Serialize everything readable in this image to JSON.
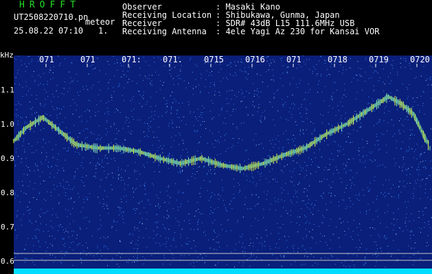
{
  "header": {
    "app_title": "HROFFT",
    "filename": "UT2508220710.pn",
    "meteor_tag": "meteor",
    "timestamp": "25.08.22 07:10",
    "count": "1.",
    "info": [
      {
        "key": "Observer",
        "value": ": Masaki Kano"
      },
      {
        "key": "Receiving Location",
        "value": ": Shibukawa, Gunma, Japan"
      },
      {
        "key": "Receiver",
        "value": ": SDR# 43dB L15 111.6MHz USB"
      },
      {
        "key": "Receiving Antenna",
        "value": ": 4ele Yagi Az 230 for Kansai VOR"
      }
    ]
  },
  "chart_data": {
    "type": "spectrogram",
    "ylabel": "kHz",
    "ylim": [
      0.6,
      1.2
    ],
    "yticks": [
      "1.1",
      "1.0",
      "0.9",
      "0.8",
      "0.7",
      "0.6"
    ],
    "xticks": [
      "071",
      "071",
      "071:",
      "071.",
      "0715",
      "0716",
      "071",
      "0718",
      "0719",
      "0720"
    ],
    "signal": {
      "x_minutes": [
        0,
        0.3,
        0.7,
        1.0,
        1.5,
        2.0,
        2.5,
        3.0,
        3.5,
        4.0,
        4.5,
        5.0,
        5.5,
        6.0,
        6.5,
        7.0,
        7.5,
        8.0,
        8.5,
        9.0,
        9.3,
        9.6,
        10.0
      ],
      "freq_khz": [
        0.95,
        0.99,
        1.02,
        0.99,
        0.94,
        0.93,
        0.93,
        0.92,
        0.9,
        0.885,
        0.9,
        0.88,
        0.87,
        0.885,
        0.91,
        0.93,
        0.97,
        1.0,
        1.04,
        1.08,
        1.06,
        1.03,
        0.93
      ]
    },
    "colors": {
      "background": "#0a1f7a",
      "noise": "#3a8cff",
      "signal": "#e8ff40",
      "baseline": "#00ddff"
    }
  }
}
